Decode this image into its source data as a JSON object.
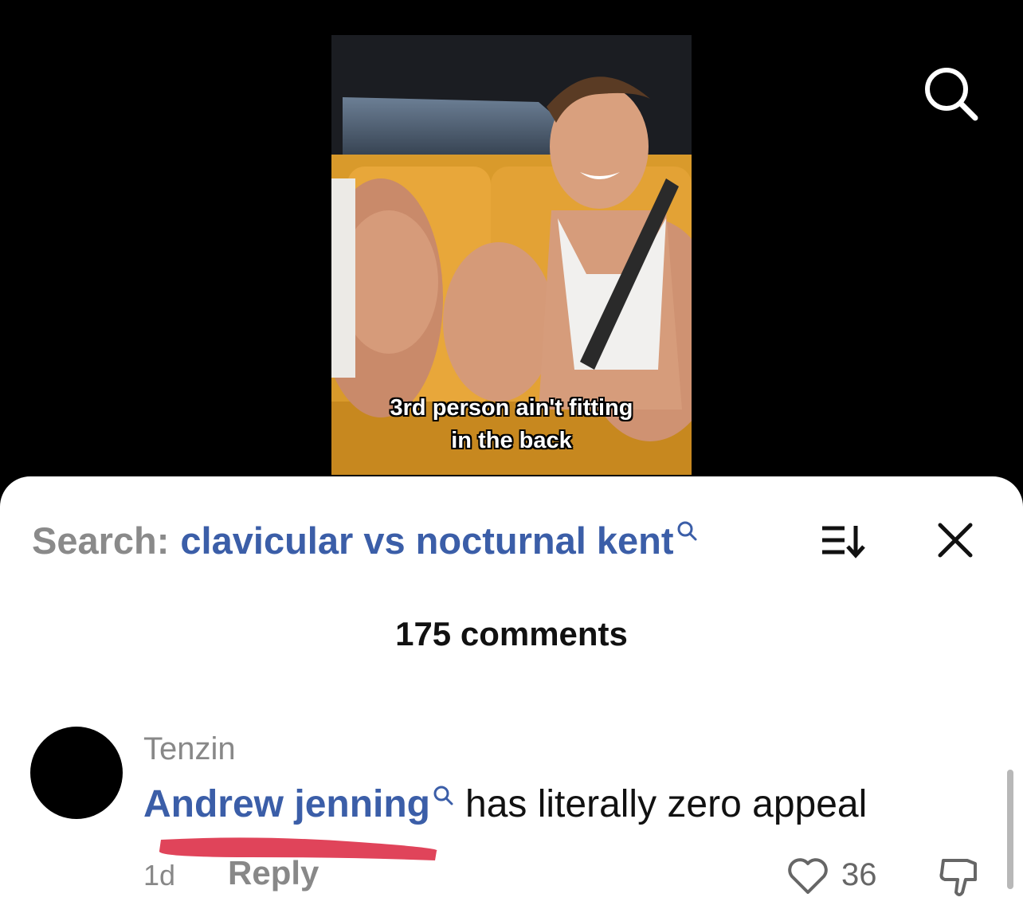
{
  "video": {
    "caption_line1": "3rd person ain't fitting",
    "caption_line2": "in the back"
  },
  "search_bar": {
    "prefix": "Search:",
    "term": "clavicular vs nocturnal kent"
  },
  "comments_header": {
    "count_label": "175 comments"
  },
  "comment": {
    "username": "Tenzin",
    "mention": "Andrew jenning",
    "text": "has literally zero appeal",
    "timestamp": "1d",
    "reply_label": "Reply",
    "likes": "36"
  },
  "icons": {
    "top_search": "search-icon",
    "sort": "sort-icon",
    "close": "close-icon",
    "like": "heart-icon",
    "dislike": "thumbs-down-icon"
  },
  "colors": {
    "link": "#3b5ea8",
    "muted": "#888888",
    "redline": "#e0445a"
  }
}
